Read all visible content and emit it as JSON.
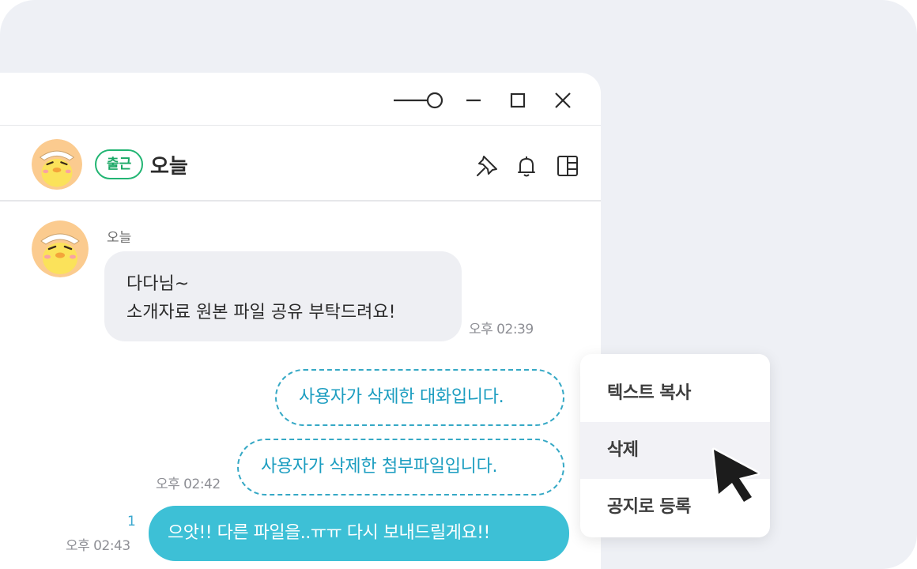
{
  "window": {
    "controls": {
      "pin_icon": "pin-slider-icon",
      "minimize_icon": "minimize-icon",
      "maximize_icon": "maximize-icon",
      "close_icon": "close-icon"
    }
  },
  "header": {
    "status_badge": "출근",
    "status_color": "#22b573",
    "title": "오늘",
    "icons": [
      "pin-icon",
      "bell-icon",
      "panel-layout-icon"
    ]
  },
  "messages": {
    "incoming": {
      "sender": "오늘",
      "lines": [
        "다다님~",
        "소개자료 원본 파일 공유 부탁드려요!"
      ],
      "time": "오후 02:39"
    },
    "deleted_message": "사용자가 삭제한 대화입니다.",
    "deleted_file": "사용자가 삭제한 첨부파일입니다.",
    "deleted_time": "오후 02:42",
    "outgoing": {
      "text": "으앗!! 다른 파일을..ㅠㅠ 다시 보내드릴게요!!",
      "unread_count": "1",
      "time": "오후 02:43"
    }
  },
  "context_menu": {
    "items": [
      "텍스트 복사",
      "삭제",
      "공지로 등록"
    ],
    "hovered_item": "삭제"
  },
  "colors": {
    "accent": "#3dc0d6",
    "deleted_border": "#35a8c5"
  }
}
